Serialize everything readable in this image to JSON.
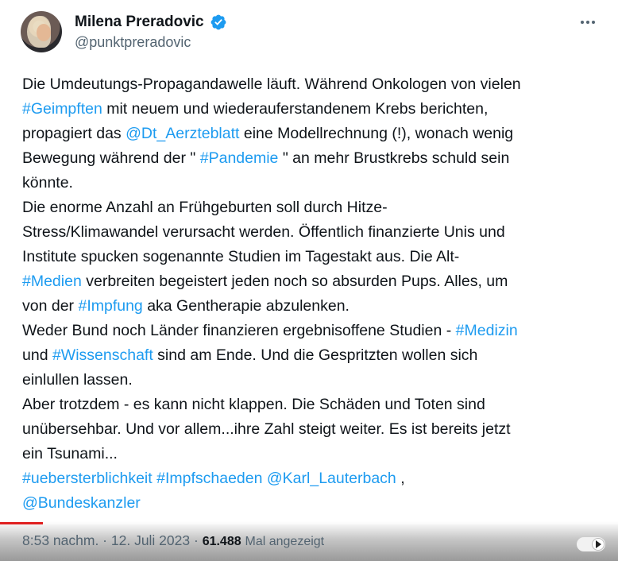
{
  "author": {
    "display_name": "Milena Preradovic",
    "handle": "@punktpreradovic",
    "verified": true,
    "verified_color": "#1d9bf0"
  },
  "link_color": "#1d9bf0",
  "tweet_lines": [
    [
      {
        "t": "Die Umdeutungs-Propagandawelle läuft. Während Onkologen von vielen"
      }
    ],
    [
      {
        "t": "#Geimpften",
        "link": true
      },
      {
        "t": " mit neuem und wiederauferstandenem Krebs berichten,"
      }
    ],
    [
      {
        "t": "propagiert das "
      },
      {
        "t": "@Dt_Aerzteblatt",
        "link": true
      },
      {
        "t": "  eine Modellrechnung (!), wonach wenig"
      }
    ],
    [
      {
        "t": "Bewegung während der \" "
      },
      {
        "t": "#Pandemie",
        "link": true
      },
      {
        "t": " \" an mehr Brustkrebs schuld sein"
      }
    ],
    [
      {
        "t": "könnte."
      }
    ],
    [
      {
        "t": "Die enorme Anzahl an  Frühgeburten soll durch Hitze-"
      }
    ],
    [
      {
        "t": "Stress/Klimawandel verursacht werden. Öffentlich finanzierte Unis und"
      }
    ],
    [
      {
        "t": "Institute spucken sogenannte Studien im Tagestakt aus. Die Alt-"
      }
    ],
    [
      {
        "t": "#Medien",
        "link": true
      },
      {
        "t": " verbreiten begeistert jeden noch so absurden Pups. Alles, um"
      }
    ],
    [
      {
        "t": "von der "
      },
      {
        "t": "#Impfung",
        "link": true
      },
      {
        "t": " aka Gentherapie abzulenken."
      }
    ],
    [
      {
        "t": "Weder Bund noch Länder finanzieren ergebnisoffene Studien - "
      },
      {
        "t": "#Medizin",
        "link": true
      }
    ],
    [
      {
        "t": "und "
      },
      {
        "t": "#Wissenschaft",
        "link": true
      },
      {
        "t": "  sind am Ende. Und die Gespritzten wollen sich"
      }
    ],
    [
      {
        "t": "einlullen lassen."
      }
    ],
    [
      {
        "t": "Aber trotzdem - es kann nicht klappen. Die Schäden und Toten sind"
      }
    ],
    [
      {
        "t": "unübersehbar. Und vor allem...ihre Zahl steigt weiter. Es ist bereits jetzt"
      }
    ],
    [
      {
        "t": "ein Tsunami..."
      }
    ],
    [
      {
        "t": "#uebersterblichkeit",
        "link": true
      },
      {
        "t": " "
      },
      {
        "t": "#Impfschaeden",
        "link": true
      },
      {
        "t": " "
      },
      {
        "t": "@Karl_Lauterbach",
        "link": true
      },
      {
        "t": " ,"
      }
    ],
    [
      {
        "t": "@Bundeskanzler",
        "link": true
      }
    ]
  ],
  "meta": {
    "time": "8:53 nachm.",
    "separator": " · ",
    "date": "12. Juli 2023",
    "views": "61.488",
    "views_label": "Mal angezeigt"
  },
  "video": {
    "progress_fraction": 0.07,
    "progress_color": "#e02020"
  },
  "icons": {
    "more": "more-horizontal-icon",
    "verified": "verified-badge-icon",
    "autoplay": "autoplay-toggle-icon"
  }
}
